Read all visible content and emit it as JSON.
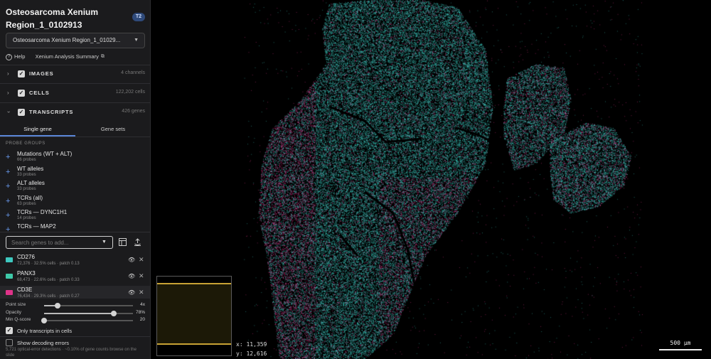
{
  "sidebar": {
    "title": "Osteosarcoma Xenium Region_1_0102913",
    "badge": "T2",
    "dataset_select": "Osteosarcoma Xenium Region_1_01029...",
    "help_label": "Help",
    "summary_link": "Xenium Analysis Summary",
    "sections": {
      "images": {
        "label": "IMAGES",
        "count": "4 channels"
      },
      "cells": {
        "label": "CELLS",
        "count": "122,202 cells"
      },
      "transcripts": {
        "label": "TRANSCRIPTS",
        "count": "426 genes"
      }
    },
    "tabs": {
      "single": "Single gene",
      "sets": "Gene sets"
    },
    "probe_groups_label": "PROBE GROUPS",
    "probe_groups": [
      {
        "name": "Mutations (WT + ALT)",
        "sub": "66 probes"
      },
      {
        "name": "WT alleles",
        "sub": "33 probes"
      },
      {
        "name": "ALT alleles",
        "sub": "33 probes"
      },
      {
        "name": "TCRs (all)",
        "sub": "63 probes"
      },
      {
        "name": "TCRs — DYNC1H1",
        "sub": "14 probes"
      },
      {
        "name": "TCRs — MAP2",
        "sub": ""
      }
    ],
    "search_placeholder": "Search genes to add...",
    "genes": [
      {
        "name": "CD276",
        "sub": "72,376 · 32.5% cells · patch 0.13",
        "color": "#3ec9c0"
      },
      {
        "name": "PANX3",
        "sub": "68,473 · 22.6% cells · patch 0.33",
        "color": "#3ec9a8"
      },
      {
        "name": "CD3E",
        "sub": "76,434 · 29.3% cells · patch 0.27",
        "color": "#e0338a"
      }
    ],
    "sliders": {
      "point_size": {
        "label": "Point size",
        "value": "4x",
        "level": 0.15
      },
      "opacity": {
        "label": "Opacity",
        "value": "78%",
        "level": 0.78
      },
      "min_q": {
        "label": "Min Q-score",
        "value": "20",
        "level": 0.0
      }
    },
    "only_in_cells": "Only transcripts in cells",
    "show_errors": "Show decoding errors",
    "show_errors_sub": "5,721 optical-error detections · ~0.10% of gene counts browse on the slide"
  },
  "viewer": {
    "coord_x": "x: 11,359",
    "coord_y": "y: 12,616",
    "scale_label": "500 µm"
  },
  "colors": {
    "cyan": "#3ec9c0",
    "magenta": "#e0338a",
    "accent": "#5a86d6",
    "minimap": "#c8a234"
  }
}
